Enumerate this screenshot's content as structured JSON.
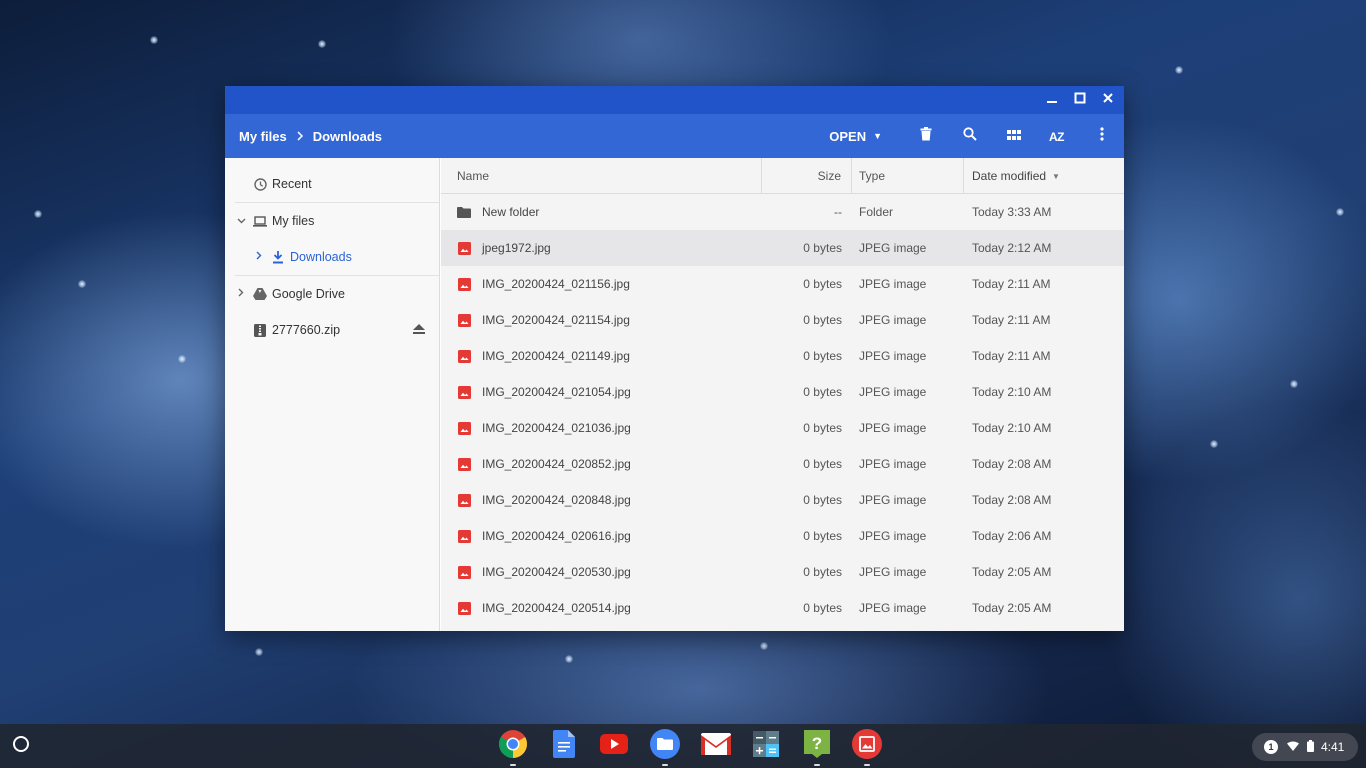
{
  "window": {
    "controls": {
      "minimize": "minimize-icon",
      "maximize": "maximize-icon",
      "close": "close-icon"
    }
  },
  "breadcrumb": {
    "root": "My files",
    "current": "Downloads"
  },
  "toolbar": {
    "open_label": "OPEN",
    "sort_label": "AZ",
    "icons": [
      "trash-icon",
      "search-icon",
      "grid-view-icon",
      "sort-icon",
      "more-vert-icon"
    ]
  },
  "sidebar": {
    "recent": "Recent",
    "my_files": "My files",
    "downloads": "Downloads",
    "google_drive": "Google Drive",
    "zip": "2777660.zip"
  },
  "columns": {
    "name": "Name",
    "size": "Size",
    "type": "Type",
    "date": "Date modified"
  },
  "files": [
    {
      "name": "New folder",
      "size": "--",
      "type": "Folder",
      "date": "Today 3:33 AM",
      "kind": "folder"
    },
    {
      "name": "jpeg1972.jpg",
      "size": "0 bytes",
      "type": "JPEG image",
      "date": "Today 2:12 AM",
      "kind": "image"
    },
    {
      "name": "IMG_20200424_021156.jpg",
      "size": "0 bytes",
      "type": "JPEG image",
      "date": "Today 2:11 AM",
      "kind": "image"
    },
    {
      "name": "IMG_20200424_021154.jpg",
      "size": "0 bytes",
      "type": "JPEG image",
      "date": "Today 2:11 AM",
      "kind": "image"
    },
    {
      "name": "IMG_20200424_021149.jpg",
      "size": "0 bytes",
      "type": "JPEG image",
      "date": "Today 2:11 AM",
      "kind": "image"
    },
    {
      "name": "IMG_20200424_021054.jpg",
      "size": "0 bytes",
      "type": "JPEG image",
      "date": "Today 2:10 AM",
      "kind": "image"
    },
    {
      "name": "IMG_20200424_021036.jpg",
      "size": "0 bytes",
      "type": "JPEG image",
      "date": "Today 2:10 AM",
      "kind": "image"
    },
    {
      "name": "IMG_20200424_020852.jpg",
      "size": "0 bytes",
      "type": "JPEG image",
      "date": "Today 2:08 AM",
      "kind": "image"
    },
    {
      "name": "IMG_20200424_020848.jpg",
      "size": "0 bytes",
      "type": "JPEG image",
      "date": "Today 2:08 AM",
      "kind": "image"
    },
    {
      "name": "IMG_20200424_020616.jpg",
      "size": "0 bytes",
      "type": "JPEG image",
      "date": "Today 2:06 AM",
      "kind": "image"
    },
    {
      "name": "IMG_20200424_020530.jpg",
      "size": "0 bytes",
      "type": "JPEG image",
      "date": "Today 2:05 AM",
      "kind": "image"
    },
    {
      "name": "IMG_20200424_020514.jpg",
      "size": "0 bytes",
      "type": "JPEG image",
      "date": "Today 2:05 AM",
      "kind": "image"
    }
  ],
  "shelf": {
    "apps": [
      "chrome-icon",
      "docs-icon",
      "youtube-icon",
      "files-icon",
      "gmail-icon",
      "calculator-icon",
      "get-help-icon",
      "gallery-icon"
    ],
    "tray": {
      "notification_count": "1",
      "time": "4:41"
    }
  },
  "colors": {
    "titlebar": "#2154c9",
    "toolbar": "#3367d6",
    "accent": "#2b63d6",
    "image_icon": "#e53935"
  }
}
